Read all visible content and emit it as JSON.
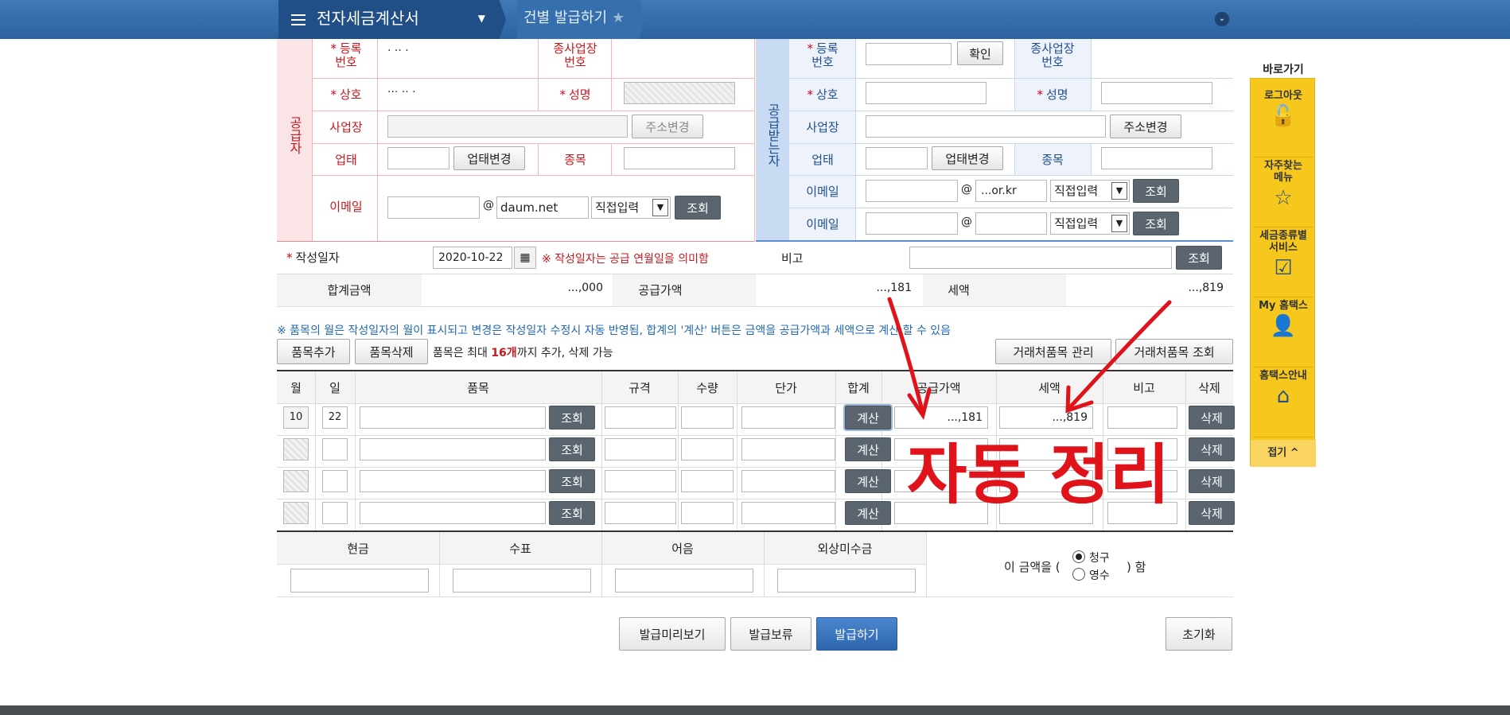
{
  "header": {
    "menu_title": "전자세금계산서",
    "crumb": "건별 발급하기"
  },
  "supplier": {
    "section_label": "공급자",
    "reg_label": "등록\n번호",
    "branch_label": "종사업장\n번호",
    "name_label": "상호",
    "ceo_label": "성명",
    "address_label": "사업장",
    "change_address": "주소변경",
    "biz_type_label": "업태",
    "change_biz_type": "업태변경",
    "item_label": "종목",
    "email_label": "이메일",
    "email_domain": "daum.net",
    "email_select": "직접입력",
    "lookup": "조회"
  },
  "receiver": {
    "section_label": "공급받는자",
    "reg_label": "등록\n번호",
    "confirm": "확인",
    "branch_label": "종사업장\n번호",
    "name_label": "상호",
    "ceo_label": "성명",
    "address_label": "사업장",
    "change_address": "주소변경",
    "biz_type_label": "업태",
    "change_biz_type": "업태변경",
    "item_label": "종목",
    "email_label": "이메일",
    "email1_domain": "...or.kr",
    "email_select": "직접입력",
    "lookup": "조회"
  },
  "doc": {
    "date_label": "작성일자",
    "date_value": "2020-10-22",
    "date_note": "※ 작성일자는 공급 연월일을 의미함",
    "note_label": "비고",
    "lookup": "조회",
    "total_label": "합계금액",
    "total_value": "...,000",
    "supply_label": "공급가액",
    "supply_value": "...,181",
    "tax_label": "세액",
    "tax_value": "...,819"
  },
  "notice": "※ 품목의 월은 작성일자의 월이 표시되고 변경은 작성일자 수정시 자동 반영됨, 합계의 '계산' 버튼은 금액을 공급가액과 세액으로 계산 할 수 있음",
  "items_toolbar": {
    "add": "품목추가",
    "delete": "품목삭제",
    "limit_prefix": "품목은 최대 ",
    "limit_count": "16개",
    "limit_suffix": "까지 추가, 삭제 가능",
    "manage": "거래처품목 관리",
    "lookup": "거래처품목 조회"
  },
  "items_table": {
    "headers": [
      "월",
      "일",
      "품목",
      "규격",
      "수량",
      "단가",
      "합계",
      "공급가액",
      "세액",
      "비고",
      "삭제"
    ],
    "lookup": "조회",
    "calc": "계산",
    "delete": "삭제",
    "rows": [
      {
        "month": "10",
        "day": "22",
        "supply": "...,181",
        "tax": "...,819"
      },
      {
        "month": "",
        "day": "",
        "supply": "",
        "tax": ""
      },
      {
        "month": "",
        "day": "",
        "supply": "",
        "tax": ""
      },
      {
        "month": "",
        "day": "",
        "supply": "",
        "tax": ""
      }
    ]
  },
  "payment": {
    "headers": [
      "현금",
      "수표",
      "어음",
      "외상미수금"
    ],
    "prefix": "이 금액을 (",
    "opt1": "청구",
    "opt2": "영수",
    "suffix": ") 함"
  },
  "actions": {
    "preview": "발급미리보기",
    "hold": "발급보류",
    "issue": "발급하기",
    "reset": "초기화"
  },
  "annotation": {
    "text": "자동 정리",
    "color": "#e0121a"
  },
  "quickmenu": {
    "title": "바로가기",
    "items": [
      "로그아웃",
      "자주찾는\n메뉴",
      "세금종류별\n서비스",
      "My 홈택스",
      "홈택스안내"
    ],
    "collapse": "접기 ^"
  },
  "colors": {
    "accent": "#2c62a0",
    "supplier": "#fbe4e6",
    "receiver": "#c9dbf3"
  }
}
